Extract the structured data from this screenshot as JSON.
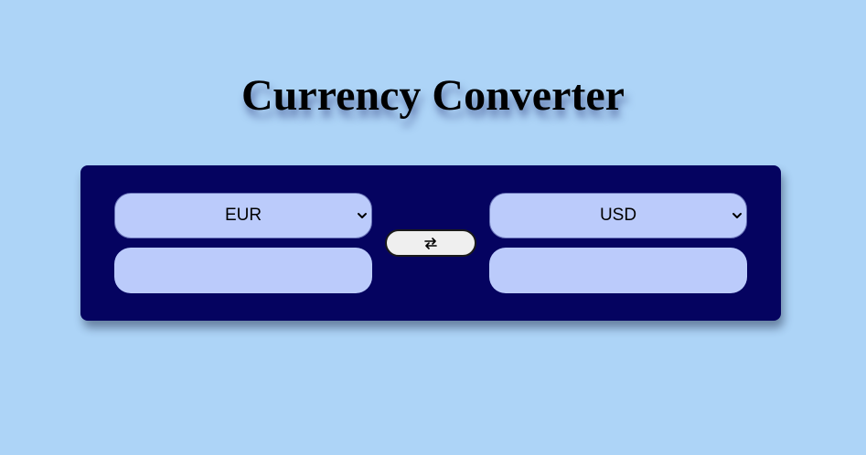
{
  "page": {
    "title": "Currency Converter"
  },
  "converter": {
    "from": {
      "currency": "EUR",
      "amount": "",
      "amount_placeholder": ""
    },
    "to": {
      "currency": "USD",
      "amount": "",
      "amount_placeholder": ""
    },
    "swap_icon": "swap-arrows-icon",
    "select_icon": "chevron-down-icon"
  },
  "colors": {
    "background": "#add4f7",
    "panel": "#050360",
    "control": "#bbcbfb",
    "swap_button": "#efefef"
  }
}
